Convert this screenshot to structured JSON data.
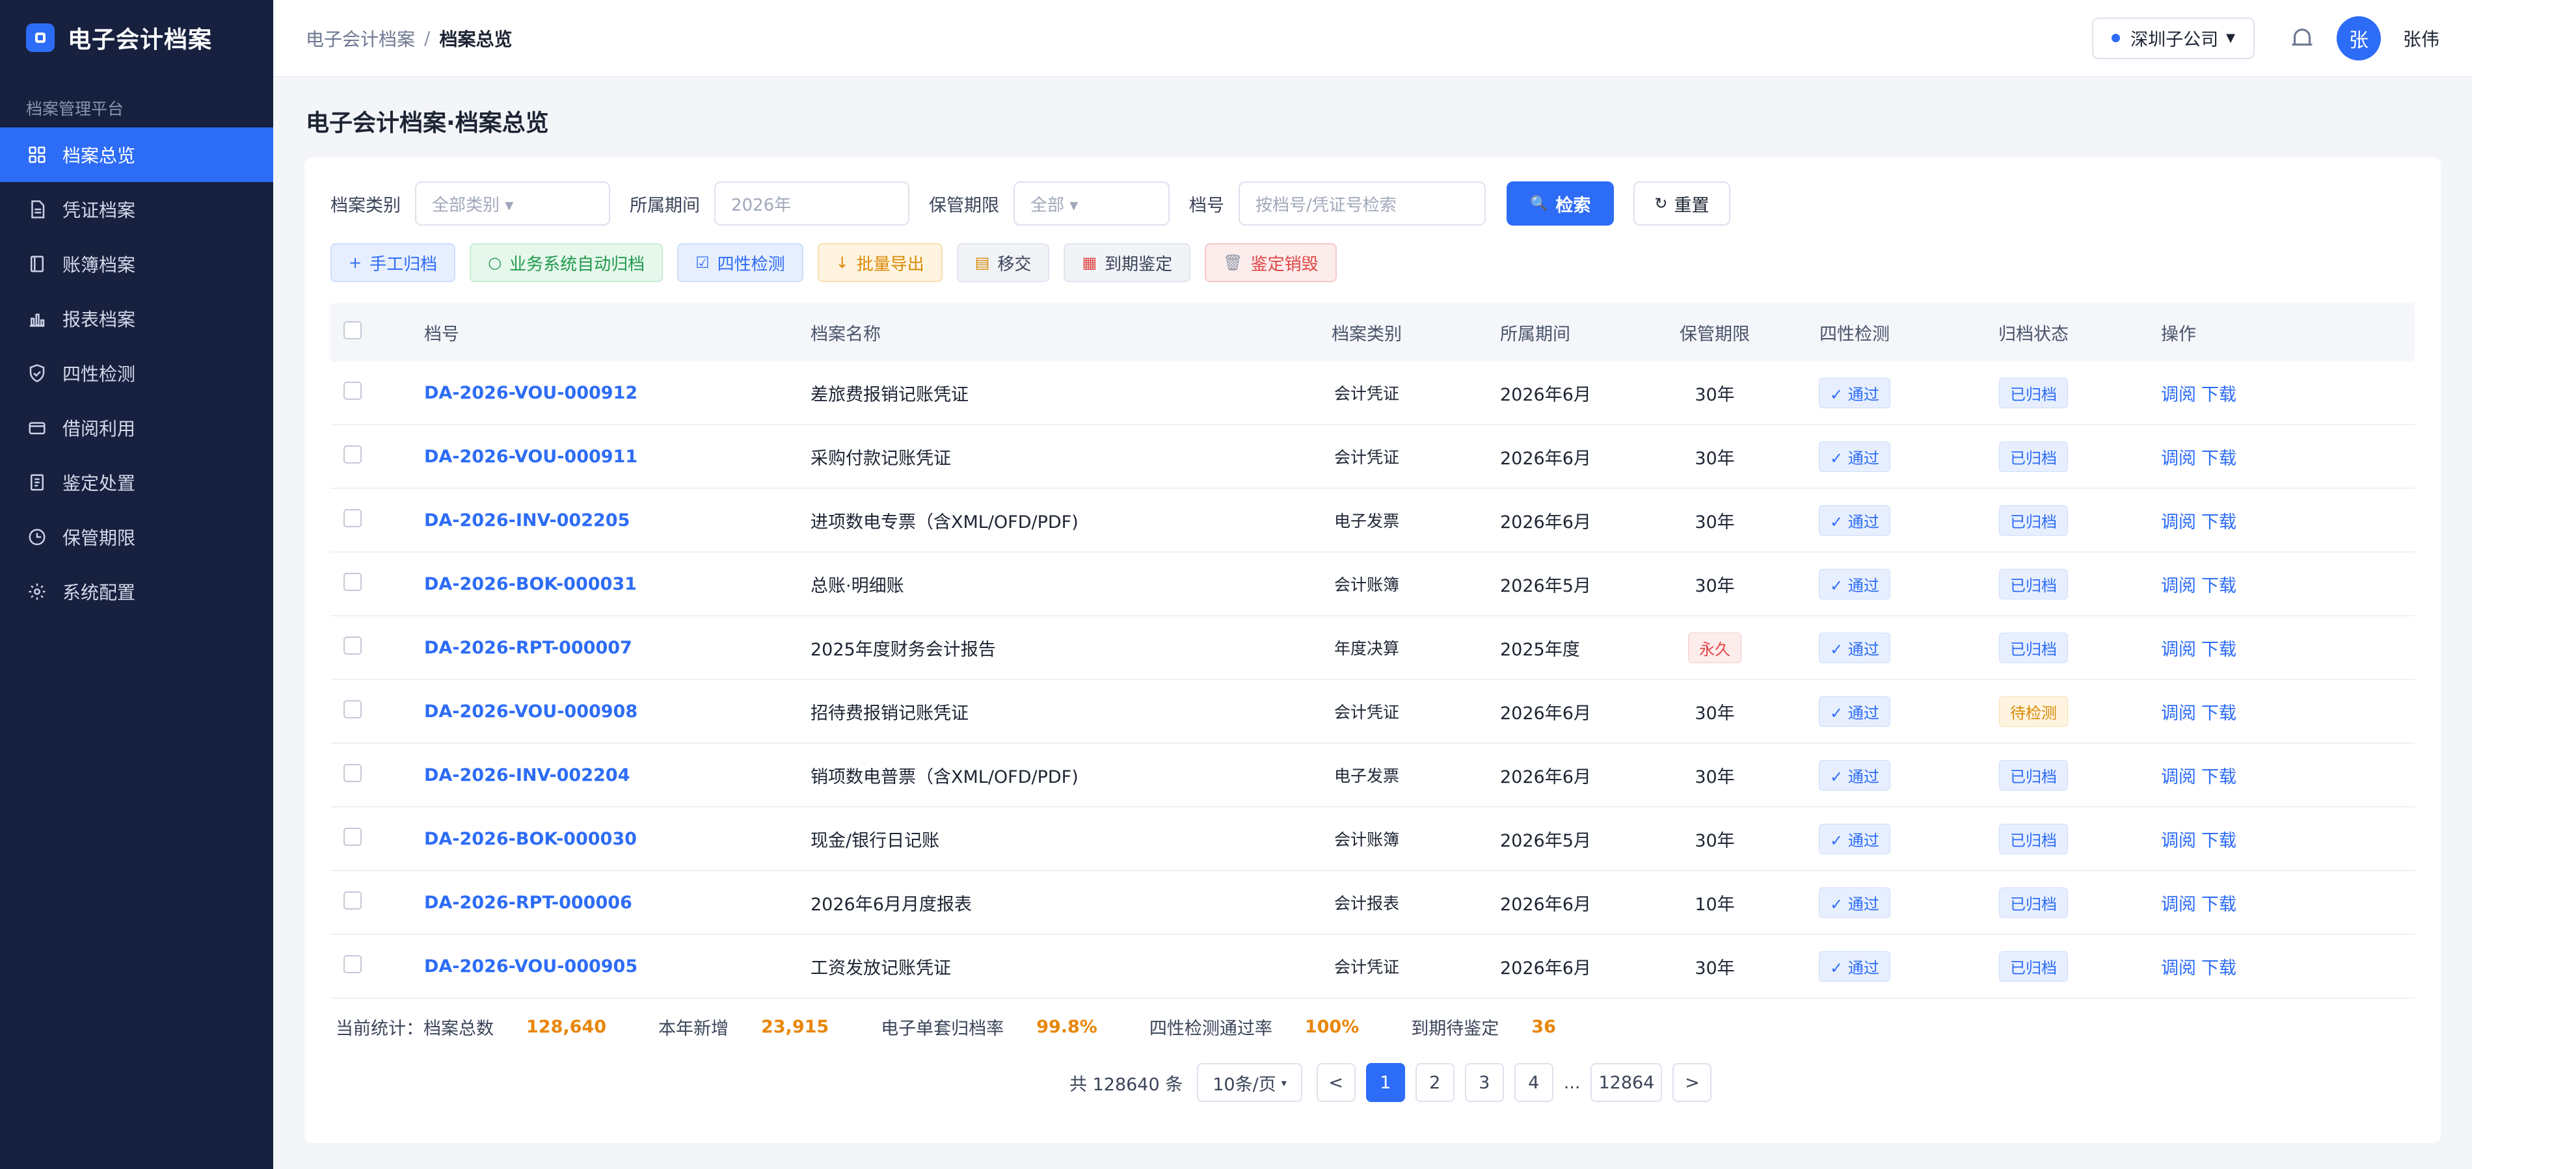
{
  "brand": {
    "title": "电子会计档案"
  },
  "sidebar": {
    "section_label": "档案管理平台",
    "items": [
      {
        "label": "档案总览",
        "icon": "grid-icon"
      },
      {
        "label": "凭证档案",
        "icon": "document-icon"
      },
      {
        "label": "账簿档案",
        "icon": "book-icon"
      },
      {
        "label": "报表档案",
        "icon": "bar-chart-icon"
      },
      {
        "label": "四性检测",
        "icon": "shield-check-icon"
      },
      {
        "label": "借阅利用",
        "icon": "wallet-icon"
      },
      {
        "label": "鉴定处置",
        "icon": "clipboard-icon"
      },
      {
        "label": "保管期限",
        "icon": "clock-icon"
      },
      {
        "label": "系统配置",
        "icon": "gear-icon"
      }
    ]
  },
  "header": {
    "breadcrumb_root": "电子会计档案",
    "breadcrumb_sep": "/",
    "breadcrumb_current": "档案总览",
    "company": "深圳子公司",
    "avatar": "张",
    "username": "张伟"
  },
  "page_title": "电子会计档案·档案总览",
  "filters": {
    "category_label": "档案类别",
    "category_value": "全部类别 ▾",
    "period_label": "所属期间",
    "period_value": "2026年",
    "retention_label": "保管期限",
    "retention_value": "全部 ▾",
    "docno_label": "档号",
    "docno_placeholder": "按档号/凭证号检索",
    "search_label": "检索",
    "reset_label": "重置"
  },
  "actions": {
    "manual_archive": "手工归档",
    "auto_archive": "业务系统自动归档",
    "four_check": "四性检测",
    "batch_export": "批量导出",
    "transfer": "移交",
    "expire_appraisal": "到期鉴定",
    "appraisal_destroy": "鉴定销毁"
  },
  "table": {
    "headers": {
      "docno": "档号",
      "name": "档案名称",
      "type": "档案类别",
      "period": "所属期间",
      "retention": "保管期限",
      "check": "四性检测",
      "status": "归档状态",
      "op": "操作"
    },
    "view_label": "调阅",
    "download_label": "下载",
    "rows": [
      {
        "docno": "DA-2026-VOU-000912",
        "name": "差旅费报销记账凭证",
        "type": "会计凭证",
        "period": "2026年6月",
        "retention": "30年",
        "check": "✓ 通过",
        "status": "已归档"
      },
      {
        "docno": "DA-2026-VOU-000911",
        "name": "采购付款记账凭证",
        "type": "会计凭证",
        "period": "2026年6月",
        "retention": "30年",
        "check": "✓ 通过",
        "status": "已归档"
      },
      {
        "docno": "DA-2026-INV-002205",
        "name": "进项数电专票（含XML/OFD/PDF)",
        "type": "电子发票",
        "period": "2026年6月",
        "retention": "30年",
        "check": "✓ 通过",
        "status": "已归档"
      },
      {
        "docno": "DA-2026-BOK-000031",
        "name": "总账·明细账",
        "type": "会计账簿",
        "period": "2026年5月",
        "retention": "30年",
        "check": "✓ 通过",
        "status": "已归档"
      },
      {
        "docno": "DA-2026-RPT-000007",
        "name": "2025年度财务会计报告",
        "type": "年度决算",
        "period": "2025年度",
        "retention": "永久",
        "check": "✓ 通过",
        "status": "已归档"
      },
      {
        "docno": "DA-2026-VOU-000908",
        "name": "招待费报销记账凭证",
        "type": "会计凭证",
        "period": "2026年6月",
        "retention": "30年",
        "check": "✓ 通过",
        "status": "待检测"
      },
      {
        "docno": "DA-2026-INV-002204",
        "name": "销项数电普票（含XML/OFD/PDF)",
        "type": "电子发票",
        "period": "2026年6月",
        "retention": "30年",
        "check": "✓ 通过",
        "status": "已归档"
      },
      {
        "docno": "DA-2026-BOK-000030",
        "name": "现金/银行日记账",
        "type": "会计账簿",
        "period": "2026年5月",
        "retention": "30年",
        "check": "✓ 通过",
        "status": "已归档"
      },
      {
        "docno": "DA-2026-RPT-000006",
        "name": "2026年6月月度报表",
        "type": "会计报表",
        "period": "2026年6月",
        "retention": "10年",
        "check": "✓ 通过",
        "status": "已归档"
      },
      {
        "docno": "DA-2026-VOU-000905",
        "name": "工资发放记账凭证",
        "type": "会计凭证",
        "period": "2026年6月",
        "retention": "30年",
        "check": "✓ 通过",
        "status": "已归档"
      }
    ]
  },
  "stats": {
    "total_label": "当前统计：档案总数",
    "total_value": "128,640",
    "new_label": "本年新增",
    "new_value": "23,915",
    "single_label": "电子单套归档率",
    "single_value": "99.8%",
    "check_label": "四性检测通过率",
    "check_value": "100%",
    "expire_label": "到期待鉴定",
    "expire_value": "36"
  },
  "pagination": {
    "total_text": "共 128640 条",
    "page_size": "10条/页",
    "prev": "<",
    "next": ">",
    "pages": [
      "1",
      "2",
      "3",
      "4"
    ],
    "ellipsis": "...",
    "last_page": "12864"
  },
  "colors": {
    "accent": "#2d6cf6",
    "sidebar_bg": "#17213f",
    "highlight": "#e8860a",
    "danger": "#e04545"
  }
}
